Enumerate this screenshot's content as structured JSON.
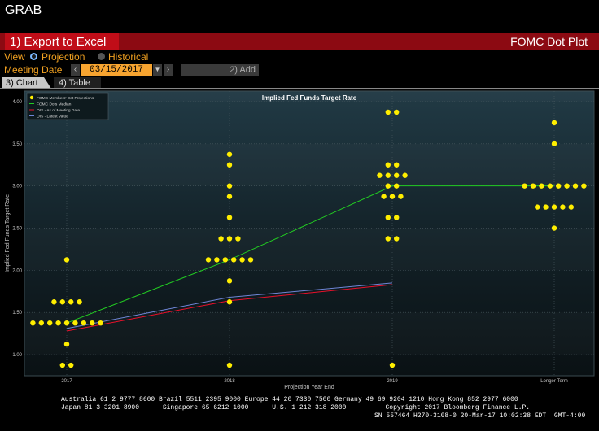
{
  "window": {
    "title": "GRAB"
  },
  "toolbar": {
    "export_label": "1) Export to Excel",
    "panel_title": "FOMC Dot Plot"
  },
  "controls": {
    "view_label": "View",
    "projection_label": "Projection",
    "historical_label": "Historical",
    "meeting_date_label": "Meeting Date",
    "meeting_date_value": "03/15/2017",
    "add_label": "2) Add"
  },
  "tabs": {
    "chart": "3) Chart",
    "table": "4) Table"
  },
  "footer": {
    "line1": "Australia 61 2 9777 8600 Brazil 5511 2395 9000 Europe 44 20 7330 7500 Germany 49 69 9204 1210 Hong Kong 852 2977 6000",
    "line2": "Japan 81 3 3201 8900      Singapore 65 6212 1000      U.S. 1 212 318 2000          Copyright 2017 Bloomberg Finance L.P.",
    "line3": "SN 557464 H270-3108-0 20-Mar-17 10:02:38 EDT  GMT-4:00"
  },
  "colors": {
    "accent_red": "#c00d18",
    "amber": "#f0a020",
    "dots": "#ffee00",
    "median": "#22cc22",
    "ois_meeting": "#e8102a",
    "ois_latest": "#6f86d6"
  },
  "chart_data": {
    "type": "scatter",
    "title": "Implied Fed Funds Target Rate",
    "xlabel": "Projection Year End",
    "ylabel": "Implied Fed Funds Target Rate",
    "categories": [
      "2017",
      "2018",
      "2019",
      "Longer Term"
    ],
    "ylim": [
      0.75,
      4.125
    ],
    "yticks": [
      "1.00",
      "1.50",
      "2.00",
      "2.50",
      "3.00",
      "3.50",
      "4.00"
    ],
    "legend": [
      "FOMC Members' Dot Projections",
      "FOMC Dots Median",
      "OIS - As of Meeting Date",
      "OIS - Latest Value"
    ],
    "legend_position": "top-left",
    "grid": true,
    "dots": [
      {
        "x": "2017",
        "rate": 2.125,
        "count": 1
      },
      {
        "x": "2017",
        "rate": 1.625,
        "count": 4
      },
      {
        "x": "2017",
        "rate": 1.375,
        "count": 9
      },
      {
        "x": "2017",
        "rate": 1.125,
        "count": 1
      },
      {
        "x": "2017",
        "rate": 0.875,
        "count": 2
      },
      {
        "x": "2018",
        "rate": 3.375,
        "count": 1
      },
      {
        "x": "2018",
        "rate": 3.25,
        "count": 1
      },
      {
        "x": "2018",
        "rate": 3.0,
        "count": 1
      },
      {
        "x": "2018",
        "rate": 2.875,
        "count": 1
      },
      {
        "x": "2018",
        "rate": 2.625,
        "count": 1
      },
      {
        "x": "2018",
        "rate": 2.375,
        "count": 3
      },
      {
        "x": "2018",
        "rate": 2.125,
        "count": 6
      },
      {
        "x": "2018",
        "rate": 1.875,
        "count": 1
      },
      {
        "x": "2018",
        "rate": 1.625,
        "count": 1
      },
      {
        "x": "2018",
        "rate": 0.875,
        "count": 1
      },
      {
        "x": "2019",
        "rate": 3.875,
        "count": 2
      },
      {
        "x": "2019",
        "rate": 3.25,
        "count": 2
      },
      {
        "x": "2019",
        "rate": 3.125,
        "count": 4
      },
      {
        "x": "2019",
        "rate": 3.0,
        "count": 2
      },
      {
        "x": "2019",
        "rate": 2.875,
        "count": 3
      },
      {
        "x": "2019",
        "rate": 2.625,
        "count": 2
      },
      {
        "x": "2019",
        "rate": 2.375,
        "count": 2
      },
      {
        "x": "2019",
        "rate": 0.875,
        "count": 1
      },
      {
        "x": "Longer Term",
        "rate": 3.75,
        "count": 1
      },
      {
        "x": "Longer Term",
        "rate": 3.5,
        "count": 1
      },
      {
        "x": "Longer Term",
        "rate": 3.0,
        "count": 8
      },
      {
        "x": "Longer Term",
        "rate": 2.75,
        "count": 5
      },
      {
        "x": "Longer Term",
        "rate": 2.5,
        "count": 1
      }
    ],
    "series": [
      {
        "name": "FOMC Dots Median",
        "x": [
          "2017",
          "2018",
          "2019",
          "Longer Term"
        ],
        "values": [
          1.375,
          2.125,
          3.0,
          3.0
        ]
      },
      {
        "name": "OIS - As of Meeting Date",
        "x": [
          "2017",
          "2018",
          "2019"
        ],
        "values": [
          1.28,
          1.64,
          1.83
        ]
      },
      {
        "name": "OIS - Latest Value",
        "x": [
          "2017",
          "2018",
          "2019"
        ],
        "values": [
          1.31,
          1.68,
          1.85
        ]
      }
    ]
  }
}
